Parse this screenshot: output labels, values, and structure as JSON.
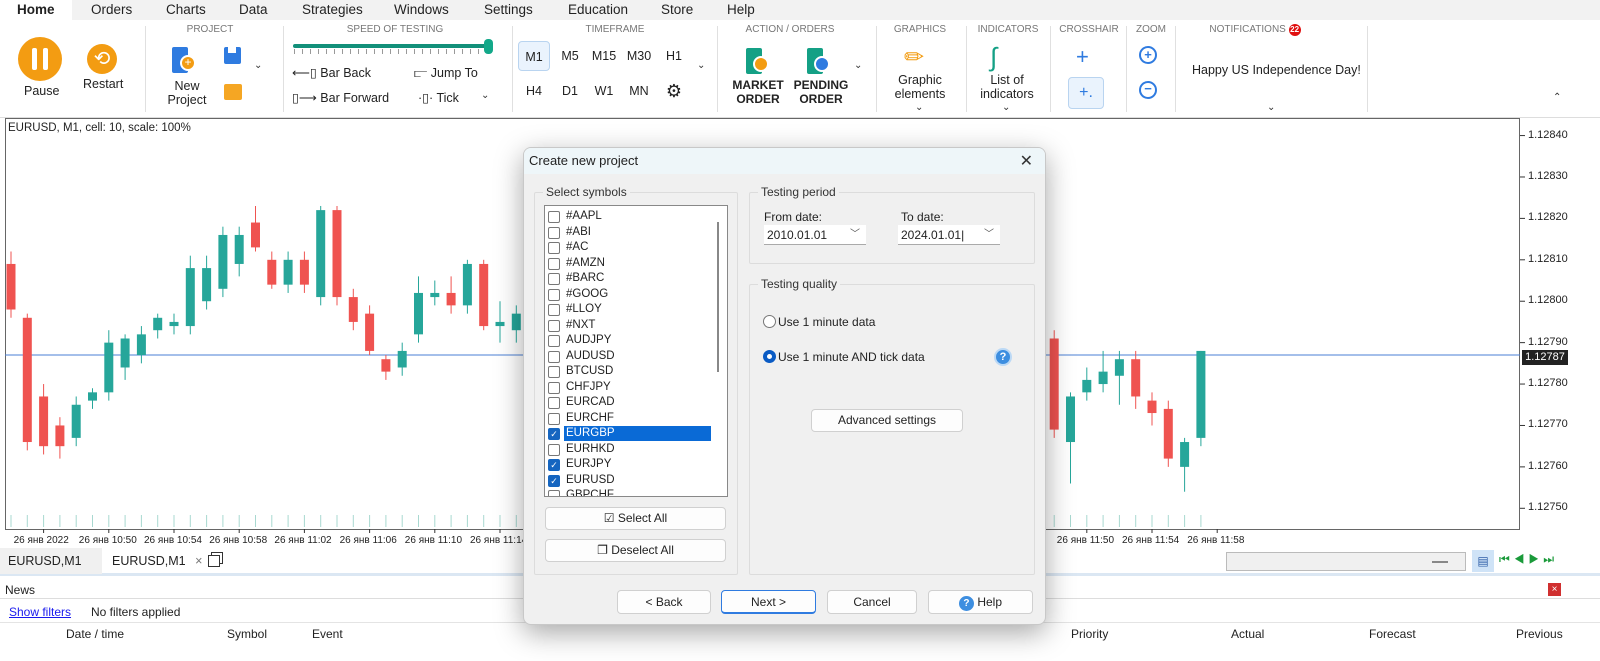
{
  "menu": [
    "Home",
    "Orders",
    "Charts",
    "Data",
    "Strategies",
    "Windows",
    "Settings",
    "Education",
    "Store",
    "Help"
  ],
  "ribbon": {
    "pause": "Pause",
    "restart": "Restart",
    "project_title": "PROJECT",
    "new_project": "New Project",
    "speed_title": "SPEED OF TESTING",
    "speed_level": 1.0,
    "bar_back": "Bar Back",
    "bar_forward": "Bar Forward",
    "jump_to": "Jump To",
    "tick": "Tick",
    "timeframe_title": "TIMEFRAME",
    "timeframes": [
      "M1",
      "M5",
      "M15",
      "M30",
      "H1",
      "H4",
      "D1",
      "W1",
      "MN"
    ],
    "selected_timeframe": "M1",
    "action_title": "ACTION / ORDERS",
    "market_order": "MARKET ORDER",
    "pending_order": "PENDING ORDER",
    "graphics_title": "GRAPHICS",
    "graphic_elements": "Graphic elements",
    "indicators_title": "INDICATORS",
    "list_of_indicators": "List of indicators",
    "crosshair_title": "CROSSHAIR",
    "zoom_title": "ZOOM",
    "notifications_title": "NOTIFICATIONS",
    "notifications_count": "22",
    "notification_text": "Happy US Independence Day!"
  },
  "colors": {
    "bull": "#26a69a",
    "bear": "#ef5350",
    "accent": "#f39c12",
    "price_line": "#4a7fd4",
    "selection": "#0a6ad6"
  },
  "chart_info": "EURUSD, M1, cell: 10, scale: 100%",
  "chart_data": {
    "type": "candlestick",
    "symbol": "EURUSD",
    "timeframe": "M1",
    "ylim": [
      1.12745,
      1.12844
    ],
    "y_ticks": [
      "1.12840",
      "1.12830",
      "1.12820",
      "1.12810",
      "1.12800",
      "1.12790",
      "1.12780",
      "1.12770",
      "1.12760",
      "1.12750"
    ],
    "current_price": "1.12787",
    "x_tick_labels": [
      [
        "10:46",
        "26 янв 2022"
      ],
      [
        "10:50",
        "26 янв 10:50"
      ],
      [
        "10:54",
        "26 янв 10:54"
      ],
      [
        "10:58",
        "26 янв 10:58"
      ],
      [
        "11:02",
        "26 янв 11:02"
      ],
      [
        "11:06",
        "26 янв 11:06"
      ],
      [
        "11:10",
        "26 янв 11:10"
      ],
      [
        "11:14",
        "26 янв 11:14"
      ],
      [
        "11:50",
        "26 янв 11:50"
      ],
      [
        "11:54",
        "26 янв 11:54"
      ],
      [
        "11:58",
        "26 янв 11:58"
      ]
    ],
    "candles": [
      [
        "10:44",
        1.12809,
        1.12812,
        1.12796,
        1.12798
      ],
      [
        "10:45",
        1.12796,
        1.12797,
        1.12764,
        1.12766
      ],
      [
        "10:46",
        1.12777,
        1.1278,
        1.12763,
        1.12765
      ],
      [
        "10:47",
        1.1277,
        1.12772,
        1.12762,
        1.12765
      ],
      [
        "10:48",
        1.12767,
        1.12777,
        1.12765,
        1.12775
      ],
      [
        "10:49",
        1.12776,
        1.12779,
        1.12774,
        1.12778
      ],
      [
        "10:50",
        1.12778,
        1.12793,
        1.12776,
        1.1279
      ],
      [
        "10:51",
        1.12784,
        1.12792,
        1.12781,
        1.12791
      ],
      [
        "10:52",
        1.12787,
        1.12794,
        1.12785,
        1.12792
      ],
      [
        "10:53",
        1.12793,
        1.12797,
        1.12791,
        1.12796
      ],
      [
        "10:54",
        1.12794,
        1.12797,
        1.12792,
        1.12795
      ],
      [
        "10:55",
        1.12794,
        1.12811,
        1.12792,
        1.12808
      ],
      [
        "10:56",
        1.128,
        1.12811,
        1.12798,
        1.12808
      ],
      [
        "10:57",
        1.12803,
        1.12818,
        1.12801,
        1.12816
      ],
      [
        "10:58",
        1.12809,
        1.12818,
        1.12806,
        1.12816
      ],
      [
        "10:59",
        1.12819,
        1.12823,
        1.12812,
        1.12813
      ],
      [
        "11:00",
        1.1281,
        1.12812,
        1.12803,
        1.12804
      ],
      [
        "11:01",
        1.12804,
        1.12812,
        1.12802,
        1.1281
      ],
      [
        "11:02",
        1.1281,
        1.12812,
        1.12802,
        1.12804
      ],
      [
        "11:03",
        1.12801,
        1.12823,
        1.12799,
        1.12822
      ],
      [
        "11:04",
        1.12822,
        1.12823,
        1.12799,
        1.12801
      ],
      [
        "11:05",
        1.12801,
        1.12803,
        1.12793,
        1.12795
      ],
      [
        "11:06",
        1.12797,
        1.12799,
        1.12787,
        1.12788
      ],
      [
        "11:07",
        1.12786,
        1.12787,
        1.12781,
        1.12783
      ],
      [
        "11:08",
        1.12784,
        1.1279,
        1.12782,
        1.12788
      ],
      [
        "11:09",
        1.12792,
        1.12806,
        1.1279,
        1.12802
      ],
      [
        "11:10",
        1.12801,
        1.12805,
        1.12799,
        1.12802
      ],
      [
        "11:11",
        1.12802,
        1.12806,
        1.12797,
        1.12799
      ],
      [
        "11:12",
        1.12799,
        1.1281,
        1.12797,
        1.12809
      ],
      [
        "11:13",
        1.12809,
        1.1281,
        1.12793,
        1.12794
      ],
      [
        "11:14",
        1.12794,
        1.128,
        1.1279,
        1.12795
      ],
      [
        "11:15",
        1.12793,
        1.12799,
        1.1279,
        1.12797
      ],
      [
        "11:48",
        1.12791,
        1.12793,
        1.12767,
        1.12769
      ],
      [
        "11:49",
        1.12766,
        1.12778,
        1.12756,
        1.12777
      ],
      [
        "11:50",
        1.12778,
        1.12784,
        1.12776,
        1.12781
      ],
      [
        "11:51",
        1.1278,
        1.12788,
        1.12778,
        1.12783
      ],
      [
        "11:52",
        1.12782,
        1.12788,
        1.12775,
        1.12786
      ],
      [
        "11:53",
        1.12786,
        1.12788,
        1.12774,
        1.12777
      ],
      [
        "11:54",
        1.12776,
        1.12778,
        1.1277,
        1.12773
      ],
      [
        "11:55",
        1.12774,
        1.12776,
        1.1276,
        1.12762
      ],
      [
        "11:56",
        1.1276,
        1.12767,
        1.12754,
        1.12766
      ],
      [
        "11:57",
        1.12767,
        1.12788,
        1.12765,
        1.12788
      ]
    ]
  },
  "chart_tabs": [
    "EURUSD,M1",
    "EURUSD,M1"
  ],
  "news": {
    "title": "News",
    "show_filters": "Show filters",
    "filters_status": "No filters applied",
    "columns": [
      "Date / time",
      "Symbol",
      "Event",
      "Priority",
      "Actual",
      "Forecast",
      "Previous"
    ]
  },
  "dialog": {
    "title": "Create new project",
    "select_symbols": "Select symbols",
    "symbols": [
      {
        "name": "#AAPL",
        "checked": false
      },
      {
        "name": "#ABI",
        "checked": false
      },
      {
        "name": "#AC",
        "checked": false
      },
      {
        "name": "#AMZN",
        "checked": false
      },
      {
        "name": "#BARC",
        "checked": false
      },
      {
        "name": "#GOOG",
        "checked": false
      },
      {
        "name": "#LLOY",
        "checked": false
      },
      {
        "name": "#NXT",
        "checked": false
      },
      {
        "name": "AUDJPY",
        "checked": false
      },
      {
        "name": "AUDUSD",
        "checked": false
      },
      {
        "name": "BTCUSD",
        "checked": false
      },
      {
        "name": "CHFJPY",
        "checked": false
      },
      {
        "name": "EURCAD",
        "checked": false
      },
      {
        "name": "EURCHF",
        "checked": false
      },
      {
        "name": "EURGBP",
        "checked": true,
        "highlighted": true
      },
      {
        "name": "EURHKD",
        "checked": false
      },
      {
        "name": "EURJPY",
        "checked": true
      },
      {
        "name": "EURUSD",
        "checked": true
      },
      {
        "name": "GBPCHF",
        "checked": false
      }
    ],
    "select_all": "Select All",
    "deselect_all": "Deselect All",
    "testing_period": "Testing period",
    "from_label": "From date:",
    "from_value": "2010.01.01",
    "to_label": "To date:",
    "to_value": "2024.01.01",
    "testing_quality": "Testing quality",
    "quality_options": [
      "Use 1 minute data",
      "Use 1 minute AND tick data"
    ],
    "quality_selected": 1,
    "advanced": "Advanced settings",
    "back": "< Back",
    "next": "Next >",
    "cancel": "Cancel",
    "help": "Help"
  }
}
